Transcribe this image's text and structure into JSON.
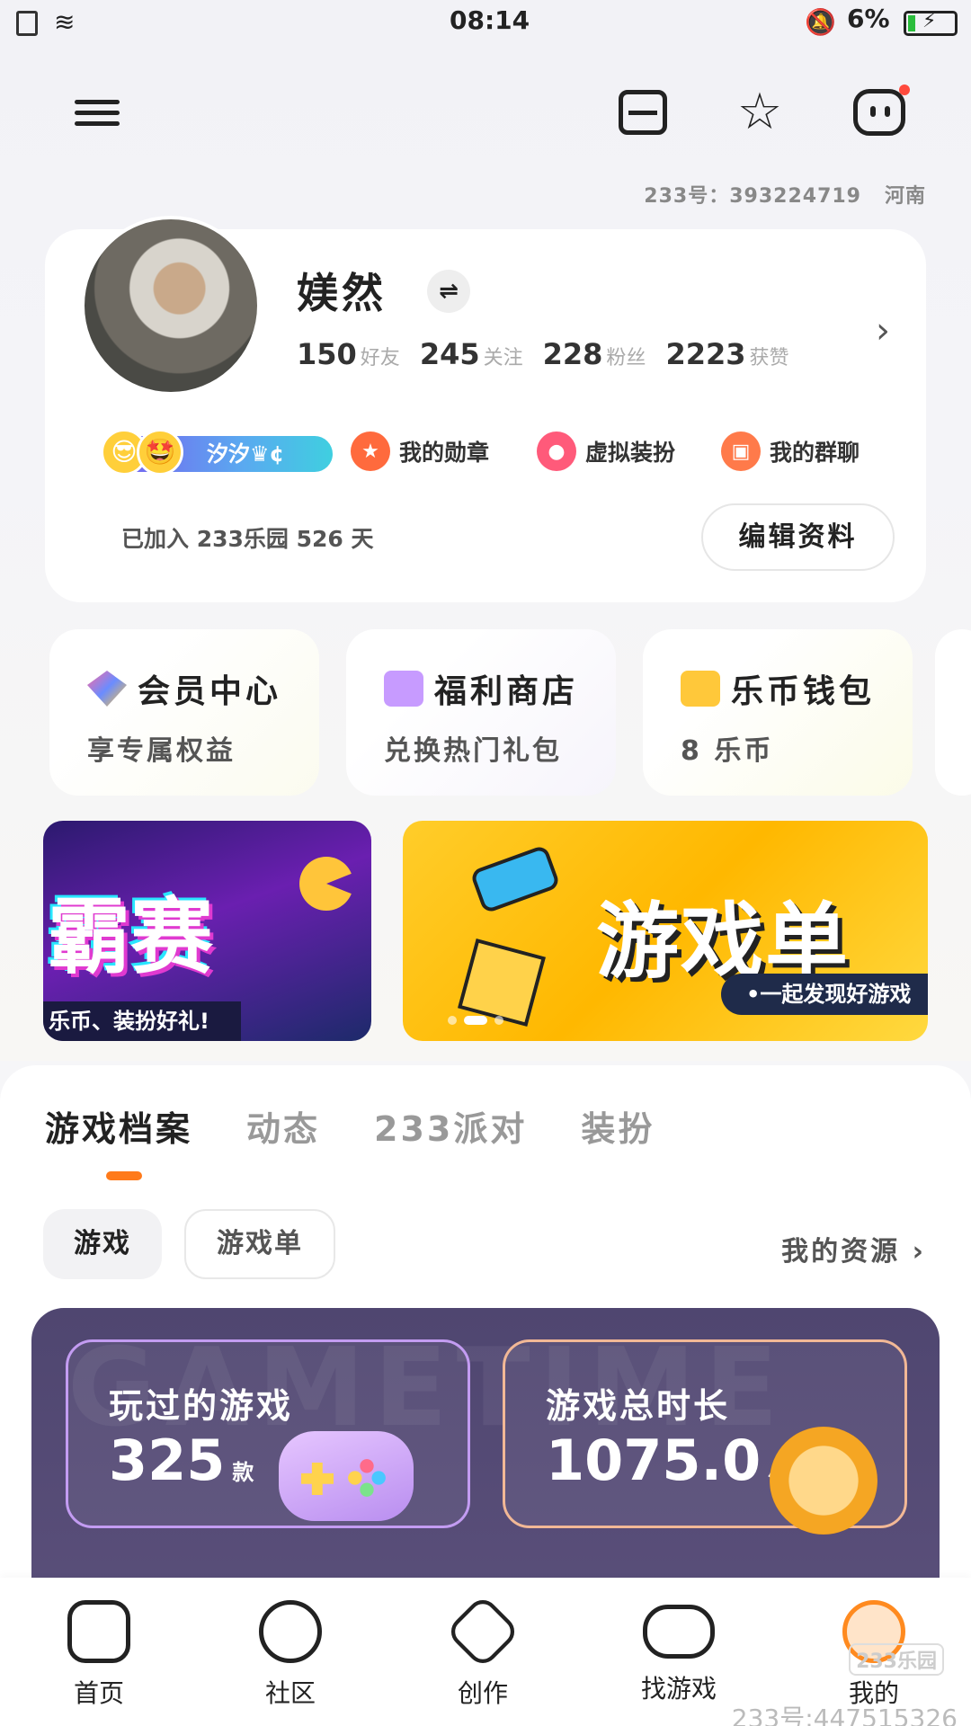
{
  "status_bar": {
    "time": "08:14",
    "battery": "6%"
  },
  "account": {
    "id_line": "233号：393224719",
    "region": "河南"
  },
  "profile": {
    "name": "媄然",
    "stats": [
      {
        "num": "150",
        "label": "好友"
      },
      {
        "num": "245",
        "label": "关注"
      },
      {
        "num": "228",
        "label": "粉丝"
      },
      {
        "num": "2223",
        "label": "获赞"
      }
    ],
    "vip_badge": "汐汐♛¢",
    "chips": [
      "我的勋章",
      "虚拟装扮",
      "我的群聊"
    ],
    "joined": "已加入 233乐园 526 天",
    "edit_label": "编辑资料"
  },
  "quick_cards": [
    {
      "title": "会员中心",
      "sub": "享专属权益"
    },
    {
      "title": "福利商店",
      "sub": "兑换热门礼包"
    },
    {
      "title": "乐币钱包",
      "sub": "8 乐币"
    }
  ],
  "banners": {
    "b1_title": "霸赛",
    "b1_sub": "乐币、装扮好礼!",
    "b2_title": "游戏单",
    "b2_sub": "•一起发现好游戏"
  },
  "tabs": [
    "游戏档案",
    "动态",
    "233派对",
    "装扮"
  ],
  "filters": {
    "game": "游戏",
    "gamelist": "游戏单",
    "resources": "我的资源"
  },
  "game_panel": {
    "watermark": "GAMETIME",
    "played_title": "玩过的游戏",
    "played_value": "325",
    "played_unit": "款",
    "duration_title": "游戏总时长",
    "duration_value": "1075.0",
    "duration_unit": "小时"
  },
  "nav": [
    "首页",
    "社区",
    "创作",
    "找游戏",
    "我的"
  ],
  "watermark": {
    "logo": "233乐园",
    "text": "233号:447515326"
  }
}
